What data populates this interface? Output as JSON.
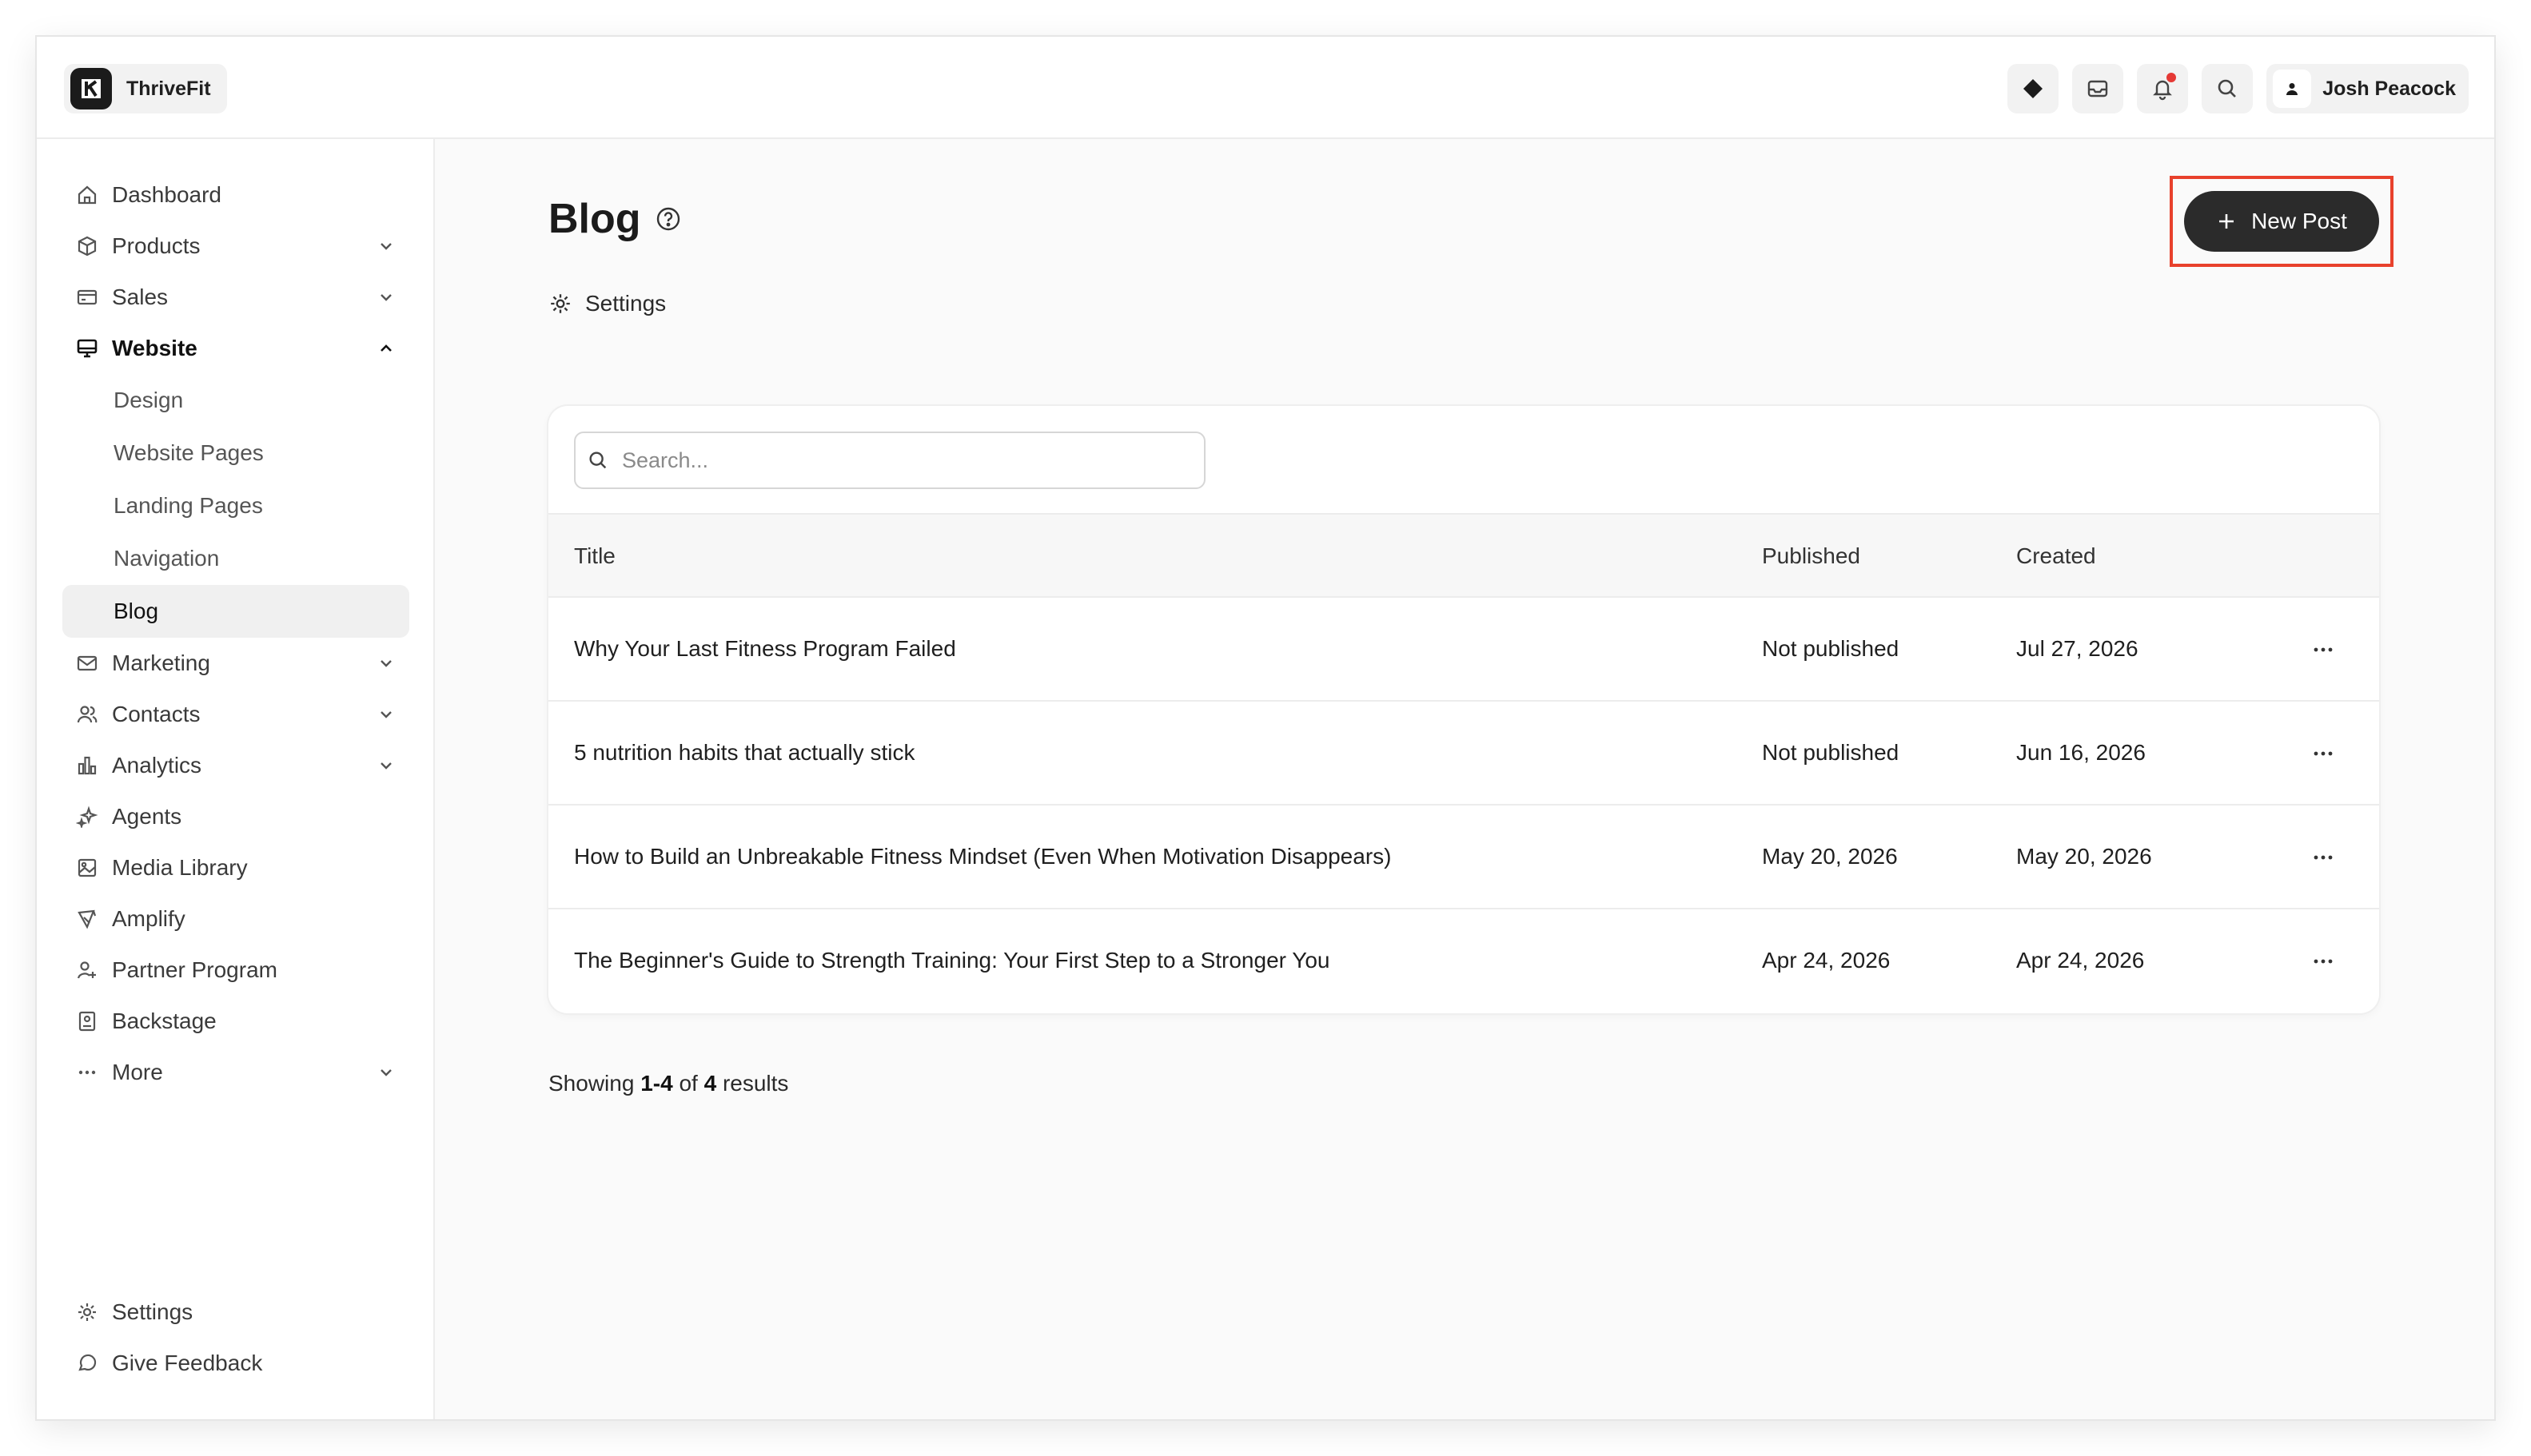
{
  "app": {
    "name": "ThriveFit",
    "user_name": "Josh Peacock"
  },
  "colors": {
    "accent": "#2b2b2b",
    "highlight_border": "#e8412c",
    "notification": "#e53935"
  },
  "sidebar": {
    "items": [
      {
        "label": "Dashboard",
        "icon": "home-icon"
      },
      {
        "label": "Products",
        "icon": "box-icon"
      },
      {
        "label": "Sales",
        "icon": "credit-card-icon"
      },
      {
        "label": "Website",
        "icon": "monitor-icon"
      },
      {
        "label": "Marketing",
        "icon": "mail-icon"
      },
      {
        "label": "Contacts",
        "icon": "users-icon"
      },
      {
        "label": "Analytics",
        "icon": "bar-chart-icon"
      },
      {
        "label": "Agents",
        "icon": "sparkles-icon"
      },
      {
        "label": "Media Library",
        "icon": "image-icon"
      },
      {
        "label": "Amplify",
        "icon": "megaphone-icon"
      },
      {
        "label": "Partner Program",
        "icon": "user-plus-icon"
      },
      {
        "label": "Backstage",
        "icon": "badge-icon"
      },
      {
        "label": "More",
        "icon": "dots-icon"
      }
    ],
    "website_sub": [
      "Design",
      "Website Pages",
      "Landing Pages",
      "Navigation",
      "Blog"
    ],
    "bottom": [
      {
        "label": "Settings",
        "icon": "gear-icon"
      },
      {
        "label": "Give Feedback",
        "icon": "chat-bubble-icon"
      }
    ]
  },
  "page": {
    "title": "Blog",
    "settings_label": "Settings",
    "new_post_label": "New Post",
    "search_placeholder": "Search..."
  },
  "table": {
    "columns": [
      "Title",
      "Published",
      "Created"
    ],
    "rows": [
      {
        "title": "Why Your Last Fitness Program Failed",
        "published": "Not published",
        "created": "Jul 27, 2026"
      },
      {
        "title": "5 nutrition habits that actually stick",
        "published": "Not published",
        "created": "Jun 16, 2026"
      },
      {
        "title": "How to Build an Unbreakable Fitness Mindset (Even When Motivation Disappears)",
        "published": "May 20, 2026",
        "created": "May 20, 2026"
      },
      {
        "title": "The Beginner's Guide to Strength Training: Your First Step to a Stronger You",
        "published": "Apr 24, 2026",
        "created": "Apr 24, 2026"
      }
    ]
  },
  "results": {
    "prefix": "Showing",
    "range": "1-4",
    "of": "of",
    "total": "4",
    "suffix": "results"
  }
}
